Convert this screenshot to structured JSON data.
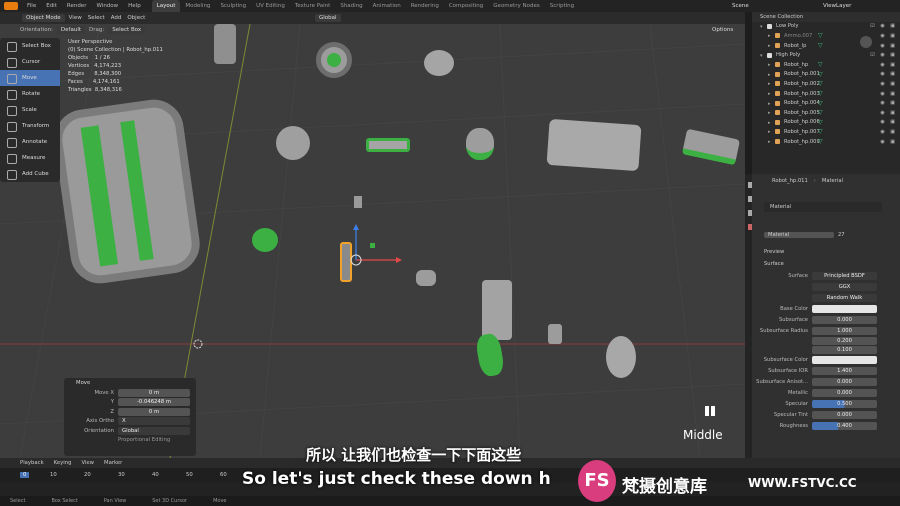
{
  "menu": [
    "File",
    "Edit",
    "Render",
    "Window",
    "Help"
  ],
  "workspaces": [
    "Layout",
    "Modeling",
    "Sculpting",
    "UV Editing",
    "Texture Paint",
    "Shading",
    "Animation",
    "Rendering",
    "Compositing",
    "Geometry Nodes",
    "Scripting"
  ],
  "scene": "Scene",
  "view_layer": "ViewLayer",
  "header": {
    "mode": "Object Mode",
    "view": "View",
    "select": "Select",
    "add": "Add",
    "object": "Object",
    "orientation_label": "Orientation:",
    "orientation": "Default",
    "drag": "Drag:",
    "drag_val": "Select Box",
    "global": "Global",
    "options": "Options"
  },
  "tools": [
    "Select Box",
    "Cursor",
    "Move",
    "Rotate",
    "Scale",
    "Transform",
    "Annotate",
    "Measure",
    "Add Cube"
  ],
  "stats": {
    "line1": "User Perspective",
    "line2": "(0) Scene Collection | Robot_hp.011",
    "objects": "Objects    1 / 26",
    "vertices": "Vertices   4,174,223",
    "edges": "Edges      8,348,300",
    "faces": "Faces      4,174,161",
    "triangles": "Triangles  8,348,316"
  },
  "operator": {
    "title": "Move",
    "move_x_label": "Move X",
    "move_x": "0 m",
    "y_label": "Y",
    "y": "-0.046248 m",
    "z_label": "Z",
    "z": "0 m",
    "axis_label": "Axis Ortho",
    "axis": "X",
    "orient_label": "Orientation",
    "orient": "Global",
    "prop": "Proportional Editing"
  },
  "outliner": {
    "root": "Scene Collection",
    "rows": [
      "Low Poly",
      "Ammo.007",
      "Robot_lp",
      "High Poly",
      "Robot_hp",
      "Robot_hp.001",
      "Robot_hp.002",
      "Robot_hp.003",
      "Robot_hp.004",
      "Robot_hp.005",
      "Robot_hp.006",
      "Robot_hp.007",
      "Robot_hp.009"
    ]
  },
  "props": {
    "object": "Robot_hp.011",
    "material_bc": "Material",
    "slot": "Material",
    "material": "Material",
    "users": "27",
    "preview": "Preview",
    "surface": "Surface",
    "surface_label": "Surface",
    "shader": "Principled BSDF",
    "dist": "GGX",
    "sss": "Random Walk",
    "rows": [
      [
        "Base Color",
        ""
      ],
      [
        "Subsurface",
        "0.000"
      ],
      [
        "Subsurface Radius",
        "1.000"
      ],
      [
        "",
        "0.200"
      ],
      [
        "",
        "0.100"
      ],
      [
        "Subsurface Color",
        ""
      ],
      [
        "Subsurface IOR",
        "1.400"
      ],
      [
        "Subsurface Anisot...",
        "0.000"
      ],
      [
        "Metallic",
        "0.000"
      ],
      [
        "Specular",
        "0.500"
      ],
      [
        "Specular Tint",
        "0.000"
      ],
      [
        "Roughness",
        "0.400"
      ]
    ]
  },
  "timeline": {
    "playback": "Playback",
    "keying": "Keying",
    "view": "View",
    "marker": "Marker",
    "frames": [
      "0",
      "10",
      "20",
      "30",
      "40",
      "50",
      "60",
      "70"
    ],
    "select": "Select",
    "box_select": "Box Select",
    "pan_view": "Pan View",
    "cursor": "Set 3D Cursor",
    "move": "Move"
  },
  "overlay": {
    "middle": "Middle",
    "sub_cn": "所以 让我们也检查一下下面这些",
    "sub_en": "So let's just check these down h",
    "logo_letters": "FS",
    "logo_cn": "梵摄创意库",
    "logo_url": "WWW.FSTVC.CC"
  }
}
